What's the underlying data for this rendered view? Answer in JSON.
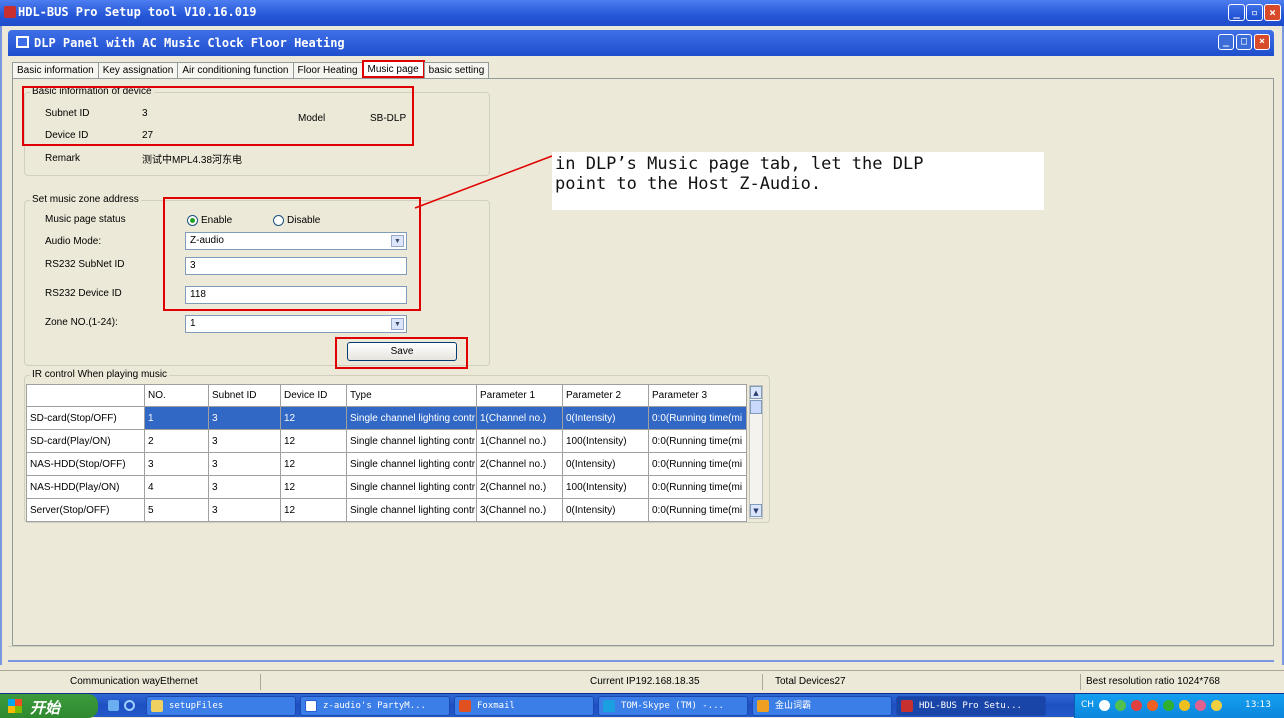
{
  "app": {
    "title": "HDL-BUS Pro Setup tool V10.16.019"
  },
  "window": {
    "title": "DLP Panel with AC Music Clock Floor Heating"
  },
  "tabs": [
    "Basic information",
    "Key assignation",
    "Air conditioning function",
    "Floor Heating",
    "Music page",
    "basic setting"
  ],
  "active_tab": "Music page",
  "device_info": {
    "legend": "Basic information of device",
    "subnet_label": "Subnet ID",
    "subnet_value": "3",
    "model_label": "Model",
    "model_value": "SB-DLP",
    "device_label": "Device ID",
    "device_value": "27",
    "remark_label": "Remark",
    "remark_value": "测试中MPL4.38河东电"
  },
  "music_zone": {
    "legend": "Set music zone address",
    "status_label": "Music page status",
    "enable_label": "Enable",
    "disable_label": "Disable",
    "status_selected": "Enable",
    "audio_mode_label": "Audio Mode:",
    "audio_mode_value": "Z-audio",
    "rs232_subnet_label": "RS232 SubNet ID",
    "rs232_subnet_value": "3",
    "rs232_device_label": "RS232 Device ID",
    "rs232_device_value": "118",
    "zone_label": "Zone NO.(1-24):",
    "zone_value": "1",
    "save_label": "Save"
  },
  "ir_control": {
    "legend": "IR control When playing music",
    "headers": [
      "",
      "NO.",
      "Subnet ID",
      "Device ID",
      "Type",
      "Parameter 1",
      "Parameter 2",
      "Parameter 3"
    ],
    "rows": [
      [
        "SD-card(Stop/OFF)",
        "1",
        "3",
        "12",
        "Single channel lighting contr",
        "1(Channel no.)",
        "0(Intensity)",
        "0:0(Running time(mi"
      ],
      [
        "SD-card(Play/ON)",
        "2",
        "3",
        "12",
        "Single channel lighting contr",
        "1(Channel no.)",
        "100(Intensity)",
        "0:0(Running time(mi"
      ],
      [
        "NAS-HDD(Stop/OFF)",
        "3",
        "3",
        "12",
        "Single channel lighting contr",
        "2(Channel no.)",
        "0(Intensity)",
        "0:0(Running time(mi"
      ],
      [
        "NAS-HDD(Play/ON)",
        "4",
        "3",
        "12",
        "Single channel lighting contr",
        "2(Channel no.)",
        "100(Intensity)",
        "0:0(Running time(mi"
      ],
      [
        "Server(Stop/OFF)",
        "5",
        "3",
        "12",
        "Single channel lighting contr",
        "3(Channel no.)",
        "0(Intensity)",
        "0:0(Running time(mi"
      ]
    ],
    "selected_row": 0
  },
  "annotation": {
    "line1": "in DLP’s Music page tab, let the DLP",
    "line2": "point to the Host Z-Audio."
  },
  "status_bar": {
    "comm": "Communication wayEthernet",
    "ip": "Current IP192.168.18.35",
    "devices": "Total Devices27",
    "resolution": "Best resolution ratio 1024*768"
  },
  "taskbar": {
    "start": "开始",
    "tasks": [
      "setupFiles",
      "z-audio's PartyM...",
      "Foxmail",
      "TOM-Skype (TM) -...",
      "金山词霸",
      "HDL-BUS Pro Setu..."
    ],
    "tray_lang": "CH",
    "clock": "13:13"
  },
  "colors": {
    "accent": "#3168c6",
    "highlight_box": "#e00000",
    "titlebar": "#2456d6"
  }
}
